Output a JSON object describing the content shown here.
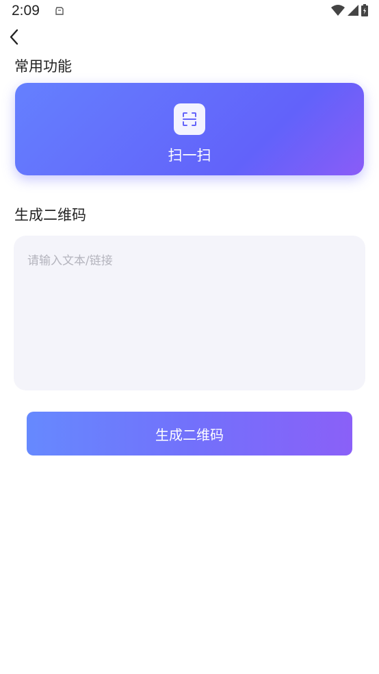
{
  "status_bar": {
    "time": "2:09",
    "icons": [
      "notification-icon",
      "wifi-icon",
      "signal-icon",
      "battery-icon"
    ]
  },
  "nav": {
    "back_icon": "chevron-left-icon"
  },
  "common_functions": {
    "title": "常用功能",
    "scan_card": {
      "label": "扫一扫",
      "icon": "scan-icon",
      "gradient": [
        "#6580fe",
        "#6262fa",
        "#8a5cf7"
      ]
    }
  },
  "qr_generator": {
    "title": "生成二维码",
    "input_placeholder": "请输入文本/链接",
    "input_value": "",
    "button_label": "生成二维码",
    "button_gradient": [
      "#6689fe",
      "#7271fb",
      "#8a60f8"
    ]
  }
}
